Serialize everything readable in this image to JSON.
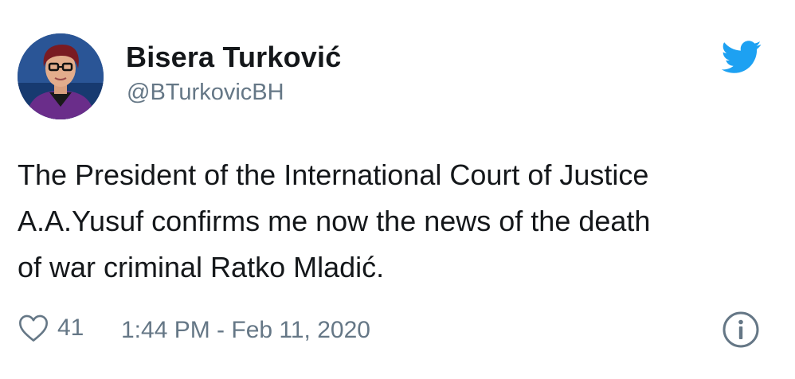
{
  "author": {
    "name": "Bisera Turković",
    "handle": "@BTurkovicBH",
    "avatar_icon": "profile-photo"
  },
  "brand": {
    "icon": "twitter-bird-icon",
    "color": "#1da1f2"
  },
  "tweet": {
    "lines": [
      "The President of the International Court of Justice",
      "A.A.Yusuf confirms me now the news of the death",
      "of war criminal Ratko Mladić."
    ]
  },
  "footer": {
    "like_icon": "heart-icon",
    "like_count": "41",
    "timestamp": "1:44 PM - Feb 11, 2020",
    "info_icon": "info-icon"
  },
  "colors": {
    "text": "#14171a",
    "muted": "#657786"
  }
}
